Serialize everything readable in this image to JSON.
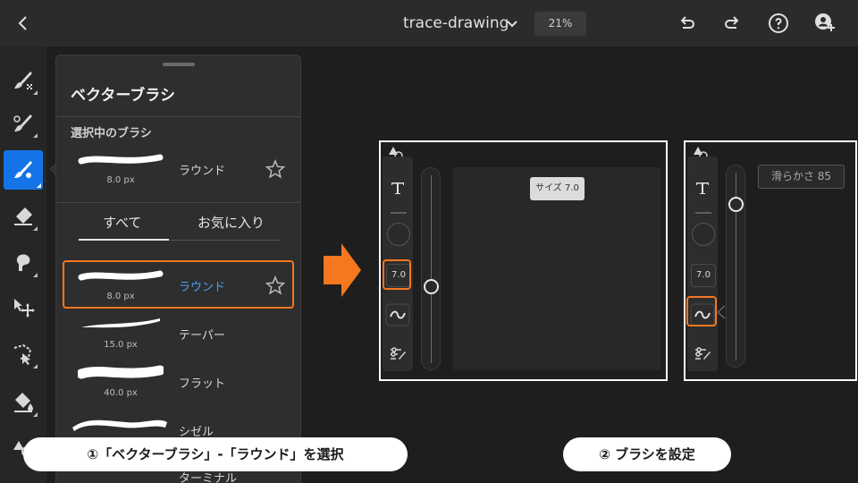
{
  "topbar": {
    "back_icon": "chevron-left-icon",
    "document_title": "trace-drawing",
    "title_menu_icon": "chevron-down-icon",
    "zoom": "21%",
    "undo_icon": "undo-icon",
    "redo_icon": "redo-icon",
    "help_icon": "help-icon",
    "invite_icon": "add-user-icon"
  },
  "left_toolbar": {
    "tools": [
      {
        "name": "pixel-brush",
        "icon": "pixel-brush-icon",
        "active": false
      },
      {
        "name": "live-brush",
        "icon": "live-brush-icon",
        "active": false
      },
      {
        "name": "vector-brush",
        "icon": "vector-brush-icon",
        "active": true
      },
      {
        "name": "eraser",
        "icon": "eraser-icon",
        "active": false
      },
      {
        "name": "smudge",
        "icon": "smudge-icon",
        "active": false
      },
      {
        "name": "transform",
        "icon": "transform-icon",
        "active": false
      },
      {
        "name": "selection",
        "icon": "lasso-icon",
        "active": false
      },
      {
        "name": "fill",
        "icon": "fill-icon",
        "active": false
      },
      {
        "name": "shape",
        "icon": "shape-icon",
        "active": false
      }
    ]
  },
  "brush_panel": {
    "title": "ベクターブラシ",
    "current_section_label": "選択中のブラシ",
    "current_brush": {
      "name": "ラウンド",
      "size": "8.0 px"
    },
    "tabs": [
      {
        "label": "すべて",
        "active": true
      },
      {
        "label": "お気に入り",
        "active": false
      }
    ],
    "brushes": [
      {
        "name": "ラウンド",
        "size": "8.0 px",
        "selected": true
      },
      {
        "name": "テーパー",
        "size": "15.0 px",
        "selected": false
      },
      {
        "name": "フラット",
        "size": "40.0 px",
        "selected": false
      },
      {
        "name": "シゼル",
        "size": "",
        "selected": false
      },
      {
        "name": "ターミナル",
        "size": "",
        "selected": false
      }
    ],
    "star_icon": "star-outline-icon"
  },
  "screenshot_size": {
    "size_value": "7.0",
    "tooltip": "サイズ 7.0",
    "text_tool_icon": "text-tool-icon",
    "smoothing_icon": "tilde-icon",
    "settings_icon": "brush-settings-icon"
  },
  "screenshot_smoothing": {
    "size_value": "7.0",
    "tooltip": "滑らかさ 85"
  },
  "steps": {
    "step1": "①「ベクターブラシ」-「ラウンド」を選択",
    "step2": "② ブラシを設定"
  },
  "colors": {
    "accent": "#1473e6",
    "highlight": "#f5771f",
    "selected_text": "#4d9ff6"
  }
}
